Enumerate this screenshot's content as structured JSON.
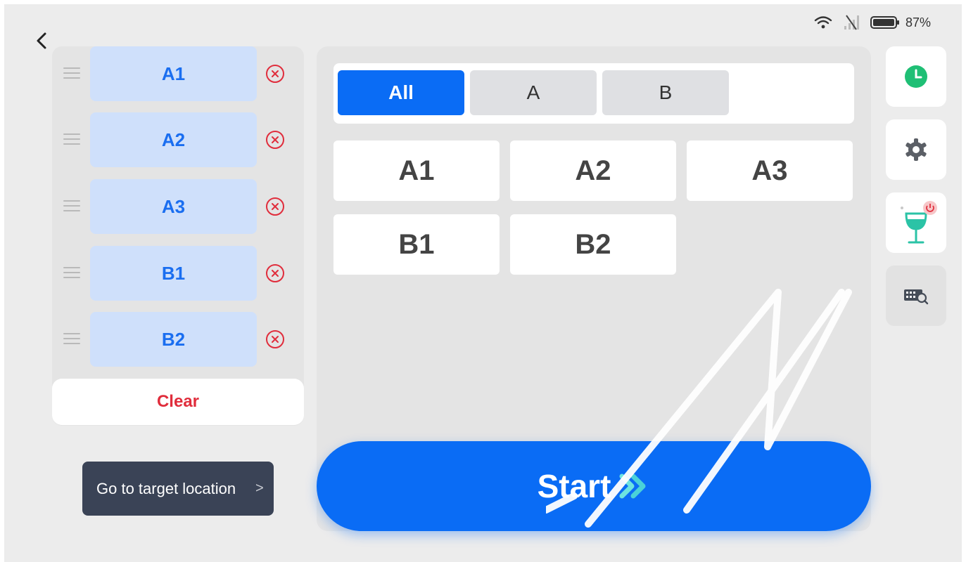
{
  "status_bar": {
    "battery": "87%"
  },
  "selected_list": {
    "items": [
      {
        "label": "A1"
      },
      {
        "label": "A2"
      },
      {
        "label": "A3"
      },
      {
        "label": "B1"
      },
      {
        "label": "B2"
      }
    ],
    "clear_label": "Clear"
  },
  "goto_button": {
    "label": "Go to target location",
    "chevron": ">"
  },
  "filter_tabs": [
    {
      "label": "All",
      "active": true
    },
    {
      "label": "A",
      "active": false
    },
    {
      "label": "B",
      "active": false
    }
  ],
  "locations": [
    "A1",
    "A2",
    "A3",
    "B1",
    "B2"
  ],
  "start_button": {
    "label": "Start"
  },
  "side_rail": [
    {
      "icon": "clock-icon"
    },
    {
      "icon": "gear-icon"
    },
    {
      "icon": "wine-glass-icon",
      "badge_icon": "power-icon"
    },
    {
      "icon": "keyboard-search-icon"
    }
  ],
  "colors": {
    "accent": "#0a6cf5",
    "chip_bg": "#cfe0fb",
    "chip_text": "#1a6ef0",
    "danger": "#e02d3c",
    "dark_button": "#3a4356",
    "clock_green": "#1fbf75",
    "glass_teal": "#2bc3a6"
  }
}
